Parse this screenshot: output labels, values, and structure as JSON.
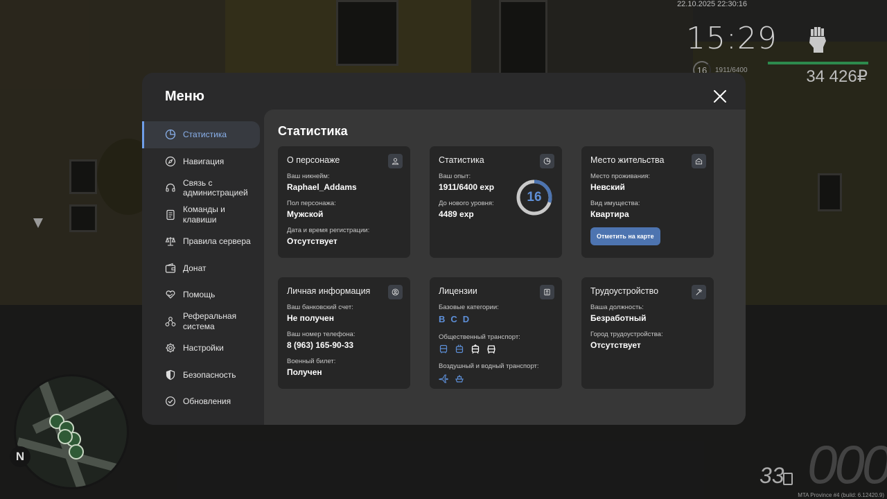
{
  "hud": {
    "datetime": "22.10.2025 22:30:16",
    "clock": "15:29",
    "level": "16",
    "exp": "1911/6400",
    "money": "34 426₽",
    "speed": "33",
    "odometer": "000",
    "build": "MTA Province #4 (build: 6.12420.9)",
    "north": "N",
    "health_color": "#2d8a4d"
  },
  "menu": {
    "title": "Меню",
    "sidebar": [
      {
        "label": "Статистика",
        "icon": "pie-chart-icon",
        "active": true
      },
      {
        "label": "Навигация",
        "icon": "compass-icon"
      },
      {
        "label": "Связь с администрацией",
        "icon": "headset-icon"
      },
      {
        "label": "Команды и клавиши",
        "icon": "document-icon"
      },
      {
        "label": "Правила сервера",
        "icon": "scales-icon"
      },
      {
        "label": "Донат",
        "icon": "wallet-icon"
      },
      {
        "label": "Помощь",
        "icon": "heart-hand-icon"
      },
      {
        "label": "Реферальная система",
        "icon": "network-icon"
      },
      {
        "label": "Настройки",
        "icon": "gear-icon"
      },
      {
        "label": "Безопасность",
        "icon": "shield-icon"
      },
      {
        "label": "Обновления",
        "icon": "check-circle-icon"
      }
    ],
    "accent": "#6f9ee8"
  },
  "content": {
    "title": "Статистика",
    "character": {
      "title": "О персонаже",
      "nick_label": "Ваш никнейм:",
      "nick": "Raphael_Addams",
      "gender_label": "Пол персонажа:",
      "gender": "Мужской",
      "reg_label": "Дата и время регистрации:",
      "reg": "Отсутствует"
    },
    "stats": {
      "title": "Статистика",
      "exp_label": "Ваш опыт:",
      "exp": "1911/6400 exp",
      "next_label": "До нового уровня:",
      "next": "4489 exp",
      "level": "16",
      "progress": 0.2986
    },
    "residence": {
      "title": "Место жительства",
      "place_label": "Место проживания:",
      "place": "Невский",
      "type_label": "Вид имущества:",
      "type": "Квартира",
      "button": "Отметить на карте"
    },
    "personal": {
      "title": "Личная информация",
      "bank_label": "Ваш банковский счет:",
      "bank": "Не получен",
      "phone_label": "Ваш номер телефона:",
      "phone": "8 (963) 165-90-33",
      "military_label": "Военный билет:",
      "military": "Получен"
    },
    "licenses": {
      "title": "Лицензии",
      "base_label": "Базовые категории:",
      "base": [
        "B",
        "C",
        "D"
      ],
      "public_label": "Общественный транспорт:",
      "air_label": "Воздушный и водный транспорт:"
    },
    "job": {
      "title": "Трудоустройство",
      "position_label": "Ваша должность:",
      "position": "Безработный",
      "city_label": "Город трудоустройства:",
      "city": "Отсутствует"
    }
  }
}
